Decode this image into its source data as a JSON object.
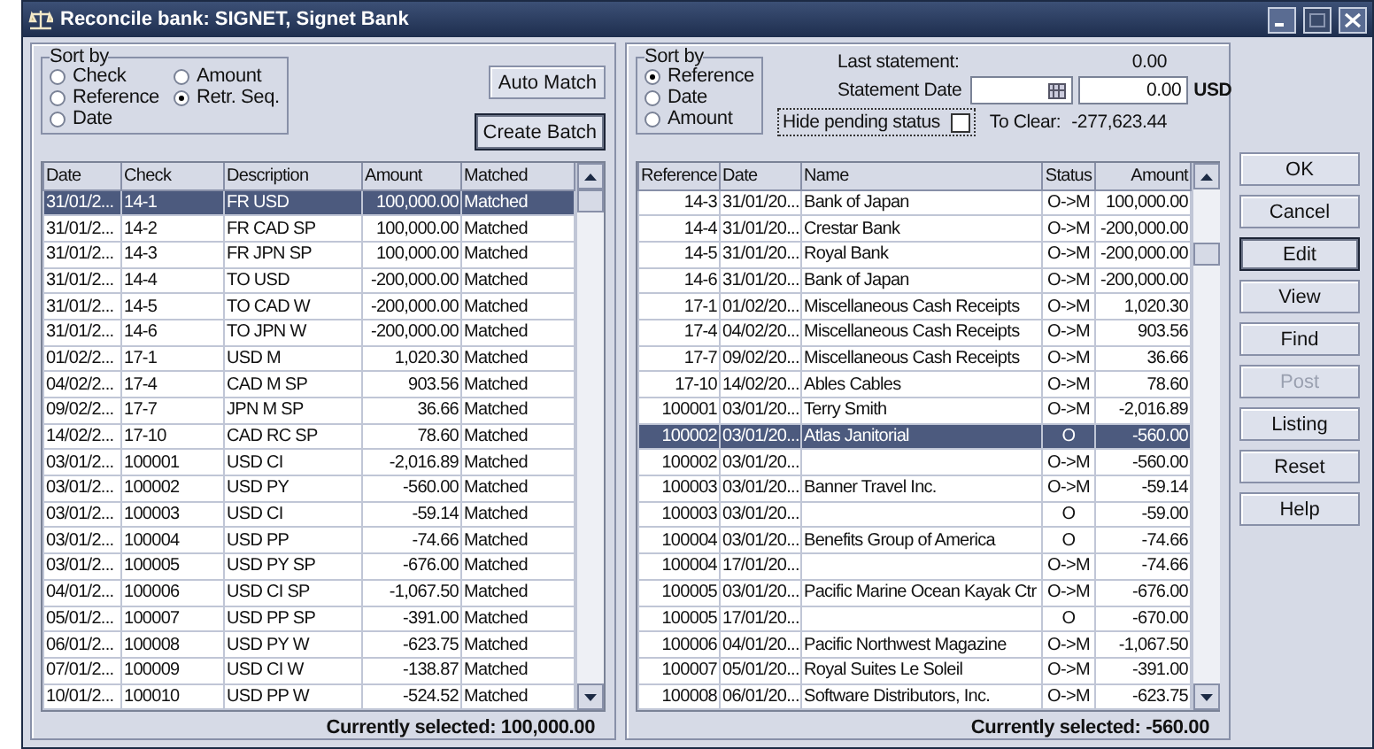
{
  "window": {
    "title": "Reconcile bank: SIGNET, Signet Bank",
    "controls": [
      {
        "kind": "minimize",
        "disabled": false
      },
      {
        "kind": "maximize",
        "disabled": true
      },
      {
        "kind": "close",
        "disabled": false
      }
    ]
  },
  "left": {
    "sort": {
      "legend": "Sort by",
      "options": [
        {
          "label": "Check",
          "selected": false
        },
        {
          "label": "Amount",
          "selected": false
        },
        {
          "label": "Reference",
          "selected": false
        },
        {
          "label": "Retr. Seq.",
          "selected": true
        },
        {
          "label": "Date",
          "selected": false
        }
      ]
    },
    "buttons": [
      {
        "label": "Auto Match",
        "focused": false
      },
      {
        "label": "Create Batch",
        "focused": true
      }
    ],
    "table": {
      "columns": [
        "Date",
        "Check",
        "Description",
        "Amount",
        "Matched"
      ],
      "rows": [
        {
          "cells": [
            "31/01/2...",
            "14-1",
            "FR USD",
            "100,000.00",
            "Matched"
          ],
          "selected": true
        },
        {
          "cells": [
            "31/01/2...",
            "14-2",
            "FR CAD SP",
            "100,000.00",
            "Matched"
          ],
          "selected": false
        },
        {
          "cells": [
            "31/01/2...",
            "14-3",
            "FR JPN SP",
            "100,000.00",
            "Matched"
          ],
          "selected": false
        },
        {
          "cells": [
            "31/01/2...",
            "14-4",
            "TO USD",
            "-200,000.00",
            "Matched"
          ],
          "selected": false
        },
        {
          "cells": [
            "31/01/2...",
            "14-5",
            "TO CAD W",
            "-200,000.00",
            "Matched"
          ],
          "selected": false
        },
        {
          "cells": [
            "31/01/2...",
            "14-6",
            "TO JPN W",
            "-200,000.00",
            "Matched"
          ],
          "selected": false
        },
        {
          "cells": [
            "01/02/2...",
            "17-1",
            "USD M",
            "1,020.30",
            "Matched"
          ],
          "selected": false
        },
        {
          "cells": [
            "04/02/2...",
            "17-4",
            "CAD M SP",
            "903.56",
            "Matched"
          ],
          "selected": false
        },
        {
          "cells": [
            "09/02/2...",
            "17-7",
            "JPN M SP",
            "36.66",
            "Matched"
          ],
          "selected": false
        },
        {
          "cells": [
            "14/02/2...",
            "17-10",
            "CAD RC SP",
            "78.60",
            "Matched"
          ],
          "selected": false
        },
        {
          "cells": [
            "03/01/2...",
            "100001",
            "USD CI",
            "-2,016.89",
            "Matched"
          ],
          "selected": false
        },
        {
          "cells": [
            "03/01/2...",
            "100002",
            "USD PY",
            "-560.00",
            "Matched"
          ],
          "selected": false
        },
        {
          "cells": [
            "03/01/2...",
            "100003",
            "USD CI",
            "-59.14",
            "Matched"
          ],
          "selected": false
        },
        {
          "cells": [
            "03/01/2...",
            "100004",
            "USD PP",
            "-74.66",
            "Matched"
          ],
          "selected": false
        },
        {
          "cells": [
            "03/01/2...",
            "100005",
            "USD PY SP",
            "-676.00",
            "Matched"
          ],
          "selected": false
        },
        {
          "cells": [
            "04/01/2...",
            "100006",
            "USD CI SP",
            "-1,067.50",
            "Matched"
          ],
          "selected": false
        },
        {
          "cells": [
            "05/01/2...",
            "100007",
            "USD PP SP",
            "-391.00",
            "Matched"
          ],
          "selected": false
        },
        {
          "cells": [
            "06/01/2...",
            "100008",
            "USD PY W",
            "-623.75",
            "Matched"
          ],
          "selected": false
        },
        {
          "cells": [
            "07/01/2...",
            "100009",
            "USD CI W",
            "-138.87",
            "Matched"
          ],
          "selected": false
        },
        {
          "cells": [
            "10/01/2...",
            "100010",
            "USD PP W",
            "-524.52",
            "Matched"
          ],
          "selected": false
        }
      ]
    },
    "footer": "Currently selected: 100,000.00"
  },
  "right": {
    "sort": {
      "legend": "Sort by",
      "options": [
        {
          "label": "Reference",
          "selected": true
        },
        {
          "label": "Date",
          "selected": false
        },
        {
          "label": "Amount",
          "selected": false
        }
      ]
    },
    "last_statement": {
      "label": "Last statement:",
      "value": "0.00"
    },
    "statement_date": {
      "label": "Statement Date",
      "amount": "0.00",
      "currency": "USD"
    },
    "hide_pending": {
      "label": "Hide pending status",
      "checked": false
    },
    "to_clear": {
      "label": "To Clear:",
      "value": "-277,623.44"
    },
    "table": {
      "columns": [
        "Reference",
        "Date",
        "Name",
        "Status",
        "Amount"
      ],
      "rows": [
        {
          "cells": [
            "14-3",
            "31/01/20...",
            "Bank of Japan",
            "O->M",
            "100,000.00"
          ],
          "selected": false
        },
        {
          "cells": [
            "14-4",
            "31/01/20...",
            "Crestar Bank",
            "O->M",
            "-200,000.00"
          ],
          "selected": false
        },
        {
          "cells": [
            "14-5",
            "31/01/20...",
            "Royal Bank",
            "O->M",
            "-200,000.00"
          ],
          "selected": false
        },
        {
          "cells": [
            "14-6",
            "31/01/20...",
            "Bank of Japan",
            "O->M",
            "-200,000.00"
          ],
          "selected": false
        },
        {
          "cells": [
            "17-1",
            "01/02/20...",
            "Miscellaneous Cash Receipts",
            "O->M",
            "1,020.30"
          ],
          "selected": false
        },
        {
          "cells": [
            "17-4",
            "04/02/20...",
            "Miscellaneous Cash Receipts",
            "O->M",
            "903.56"
          ],
          "selected": false
        },
        {
          "cells": [
            "17-7",
            "09/02/20...",
            "Miscellaneous Cash Receipts",
            "O->M",
            "36.66"
          ],
          "selected": false
        },
        {
          "cells": [
            "17-10",
            "14/02/20...",
            "Ables Cables",
            "O->M",
            "78.60"
          ],
          "selected": false
        },
        {
          "cells": [
            "100001",
            "03/01/20...",
            "Terry Smith",
            "O->M",
            "-2,016.89"
          ],
          "selected": false
        },
        {
          "cells": [
            "100002",
            "03/01/20...",
            "Atlas Janitorial",
            "O",
            "-560.00"
          ],
          "selected": true
        },
        {
          "cells": [
            "100002",
            "03/01/20...",
            "",
            "O->M",
            "-560.00"
          ],
          "selected": false
        },
        {
          "cells": [
            "100003",
            "03/01/20...",
            "Banner Travel Inc.",
            "O->M",
            "-59.14"
          ],
          "selected": false
        },
        {
          "cells": [
            "100003",
            "03/01/20...",
            "",
            "O",
            "-59.00"
          ],
          "selected": false
        },
        {
          "cells": [
            "100004",
            "03/01/20...",
            "Benefits Group of America",
            "O",
            "-74.66"
          ],
          "selected": false
        },
        {
          "cells": [
            "100004",
            "17/01/20...",
            "",
            "O->M",
            "-74.66"
          ],
          "selected": false
        },
        {
          "cells": [
            "100005",
            "03/01/20...",
            "Pacific Marine Ocean Kayak Ctr",
            "O->M",
            "-676.00"
          ],
          "selected": false
        },
        {
          "cells": [
            "100005",
            "17/01/20...",
            "",
            "O",
            "-670.00"
          ],
          "selected": false
        },
        {
          "cells": [
            "100006",
            "04/01/20...",
            "Pacific Northwest Magazine",
            "O->M",
            "-1,067.50"
          ],
          "selected": false
        },
        {
          "cells": [
            "100007",
            "05/01/20...",
            "Royal Suites Le Soleil",
            "O->M",
            "-391.00"
          ],
          "selected": false
        },
        {
          "cells": [
            "100008",
            "06/01/20...",
            "Software Distributors, Inc.",
            "O->M",
            "-623.75"
          ],
          "selected": false
        }
      ]
    },
    "footer": "Currently selected: -560.00"
  },
  "actions": [
    {
      "label": "OK",
      "disabled": false,
      "focused": false
    },
    {
      "label": "Cancel",
      "disabled": false,
      "focused": false
    },
    {
      "label": "Edit",
      "disabled": false,
      "focused": true
    },
    {
      "label": "View",
      "disabled": false,
      "focused": false
    },
    {
      "label": "Find",
      "disabled": false,
      "focused": false
    },
    {
      "label": "Post",
      "disabled": true,
      "focused": false
    },
    {
      "label": "Listing",
      "disabled": false,
      "focused": false
    },
    {
      "label": "Reset",
      "disabled": false,
      "focused": false
    },
    {
      "label": "Help",
      "disabled": false,
      "focused": false
    }
  ]
}
